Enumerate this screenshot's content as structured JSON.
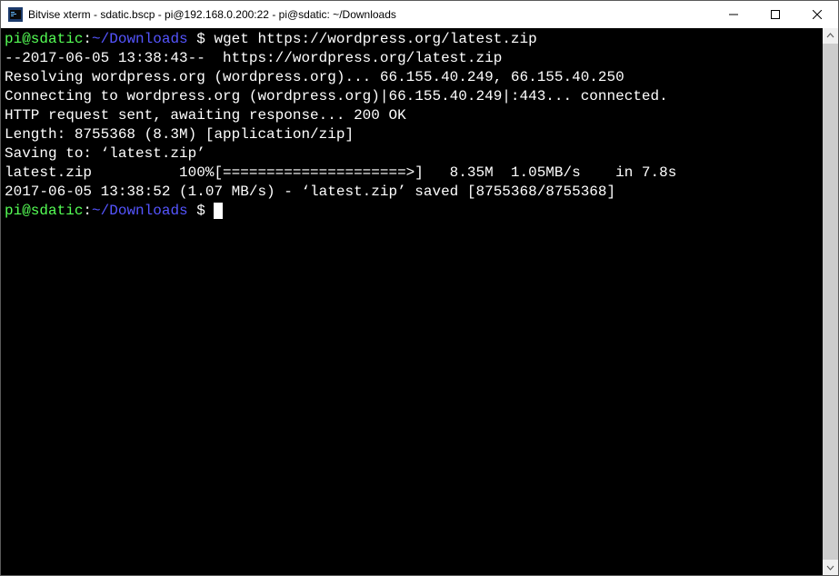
{
  "titlebar": {
    "title": "Bitvise xterm - sdatic.bscp - pi@192.168.0.200:22 - pi@sdatic: ~/Downloads"
  },
  "prompt": {
    "user_host": "pi@sdatic",
    "colon": ":",
    "path": "~/Downloads",
    "symbol": " $ "
  },
  "command": "wget https://wordpress.org/latest.zip",
  "output": {
    "l1": "--2017-06-05 13:38:43--  https://wordpress.org/latest.zip",
    "l2": "Resolving wordpress.org (wordpress.org)... 66.155.40.249, 66.155.40.250",
    "l3": "Connecting to wordpress.org (wordpress.org)|66.155.40.249|:443... connected.",
    "l4": "HTTP request sent, awaiting response... 200 OK",
    "l5": "Length: 8755368 (8.3M) [application/zip]",
    "l6": "Saving to: ‘latest.zip’",
    "blank": "",
    "progress": "latest.zip          100%[=====================>]   8.35M  1.05MB/s    in 7.8s",
    "l7": "2017-06-05 13:38:52 (1.07 MB/s) - ‘latest.zip’ saved [8755368/8755368]"
  }
}
